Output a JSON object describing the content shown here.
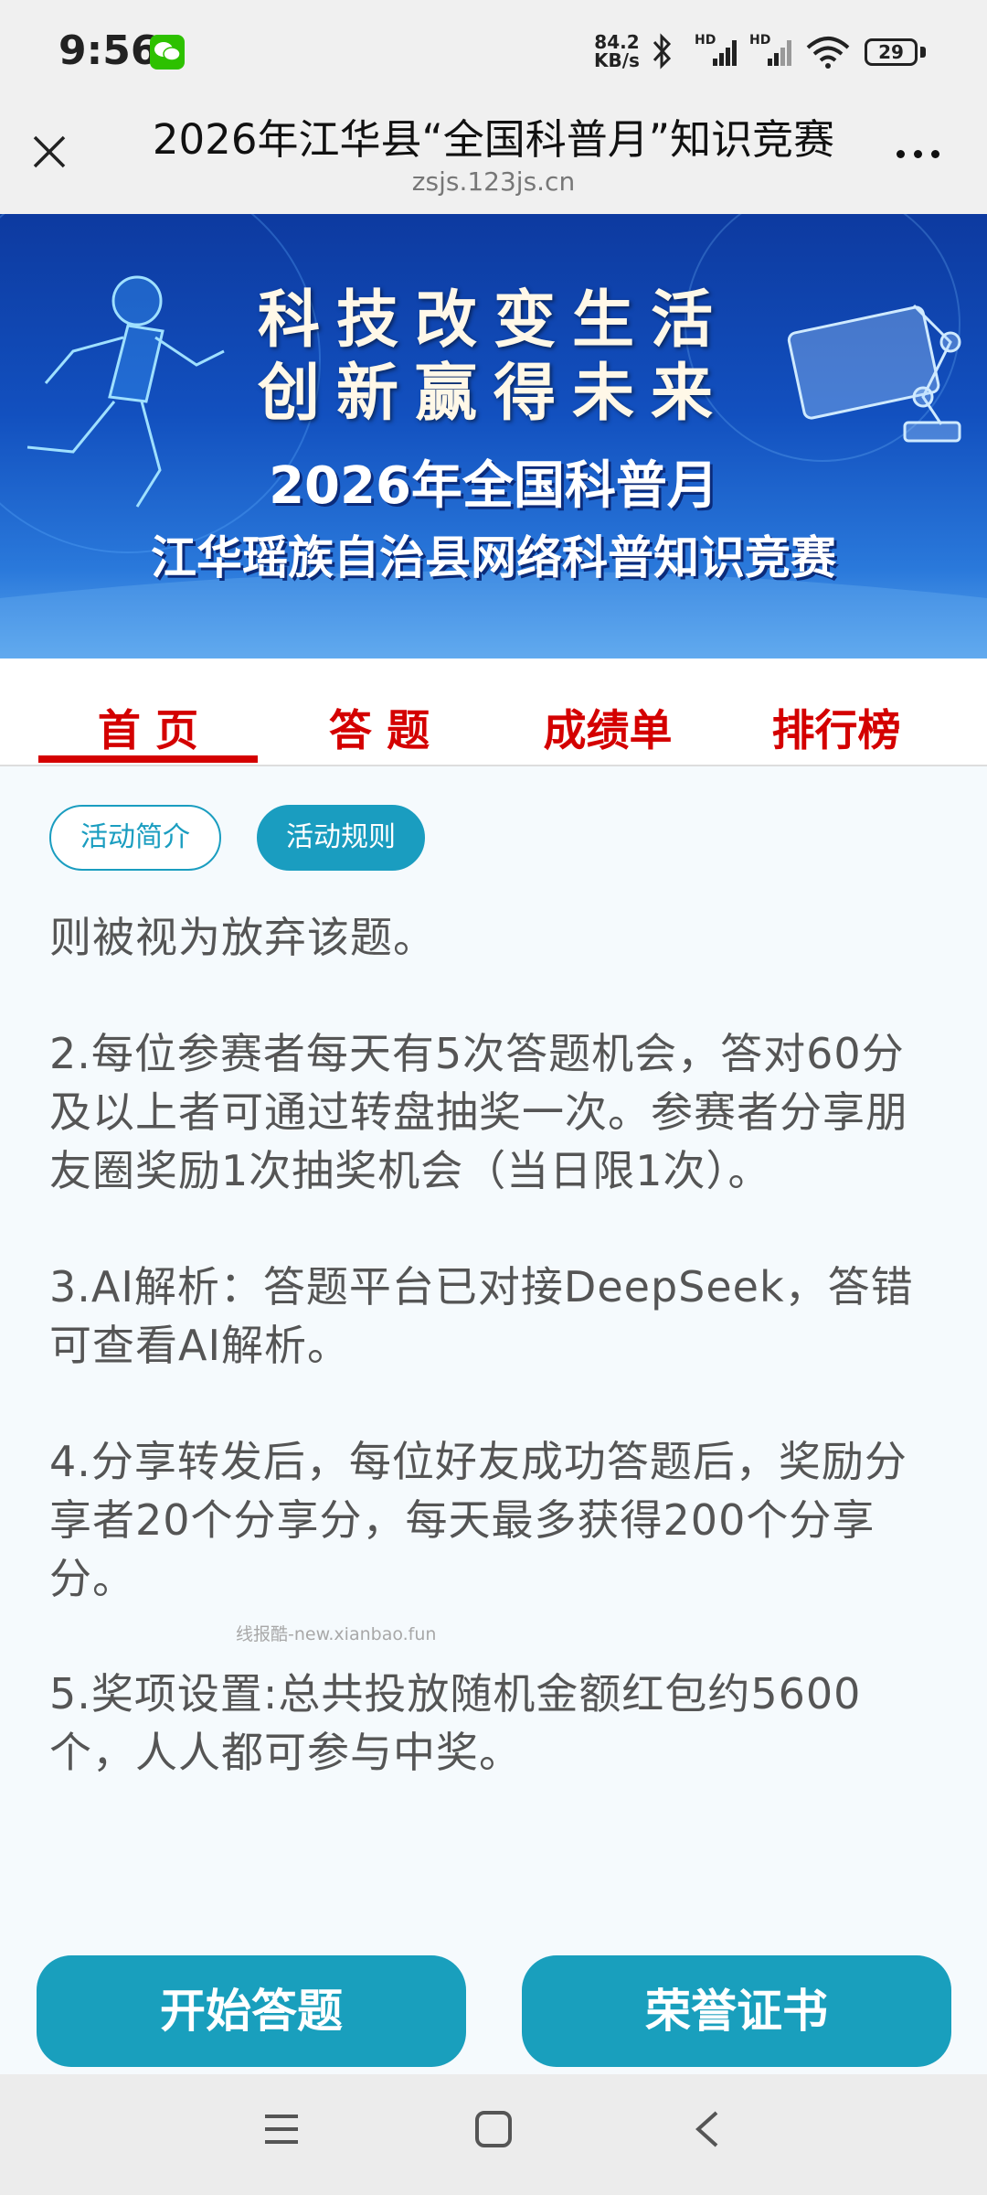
{
  "status": {
    "time": "9:56",
    "net_speed_value": "84.2",
    "net_speed_unit": "KB/s",
    "hd1": "HD",
    "hd2": "HD",
    "battery": "29"
  },
  "header": {
    "title": "2026年江华县“全国科普月”知识竞赛",
    "url": "zsjs.123js.cn"
  },
  "banner": {
    "slogan_line1": "科技改变生活",
    "slogan_line2": "创新赢得未来",
    "subtitle1": "2026年全国科普月",
    "subtitle2": "江华瑶族自治县网络科普知识竞赛"
  },
  "tabs": [
    {
      "label": "首 页",
      "active": true
    },
    {
      "label": "答 题",
      "active": false
    },
    {
      "label": "成绩单",
      "active": false
    },
    {
      "label": "排行榜",
      "active": false
    }
  ],
  "subtabs": {
    "intro": "活动简介",
    "rules": "活动规则"
  },
  "content": {
    "p0": "则被视为放弃该题。",
    "p2_line1": "2.每位参赛者每天有5次答题机会，答对60分",
    "p2_line2": "及以上者可通过转盘抽奖一次。参赛者分享朋",
    "p2_line3": "友圈奖励1次抽奖机会（当日限1次）。",
    "p3_line1": "3.AI解析：答题平台已对接DeepSeek，答错",
    "p3_line2": "可查看AI解析。",
    "p4_line1": "4.分享转发后，每位好友成功答题后，奖励分",
    "p4_line2": "享者20个分享分，每天最多获得200个分享",
    "p4_line3": "分。",
    "p5_line1": "5.奖项设置:总共投放随机金额红包约5600",
    "p5_line2": "个，人人都可参与中奖。"
  },
  "watermark": "线报酷-new.xianbao.fun",
  "buttons": {
    "start": "开始答题",
    "certificate": "荣誉证书"
  },
  "colors": {
    "accent_red": "#d40000",
    "accent_teal": "#199fbd",
    "banner_blue": "#1250bf"
  }
}
